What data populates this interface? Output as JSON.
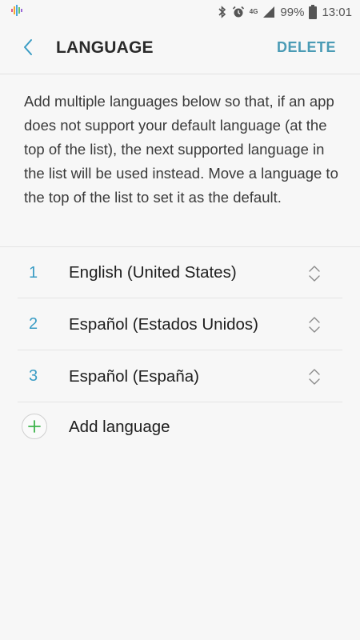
{
  "status_bar": {
    "network": "4G",
    "battery": "99%",
    "time": "13:01"
  },
  "app_bar": {
    "title": "LANGUAGE",
    "delete_label": "DELETE"
  },
  "description": "Add multiple languages below so that, if an app does not support your default language (at the top of the list), the next supported language in the list will be used instead. Move a language to the top of the list to set it as the default.",
  "languages": [
    {
      "index": "1",
      "name": "English (United States)"
    },
    {
      "index": "2",
      "name": "Español (Estados Unidos)"
    },
    {
      "index": "3",
      "name": "Español (España)"
    }
  ],
  "add_language_label": "Add language",
  "colors": {
    "accent": "#3a9cc4",
    "delete": "#4a9bb5",
    "add_icon": "#3cb34a",
    "background": "#f7f7f7"
  }
}
